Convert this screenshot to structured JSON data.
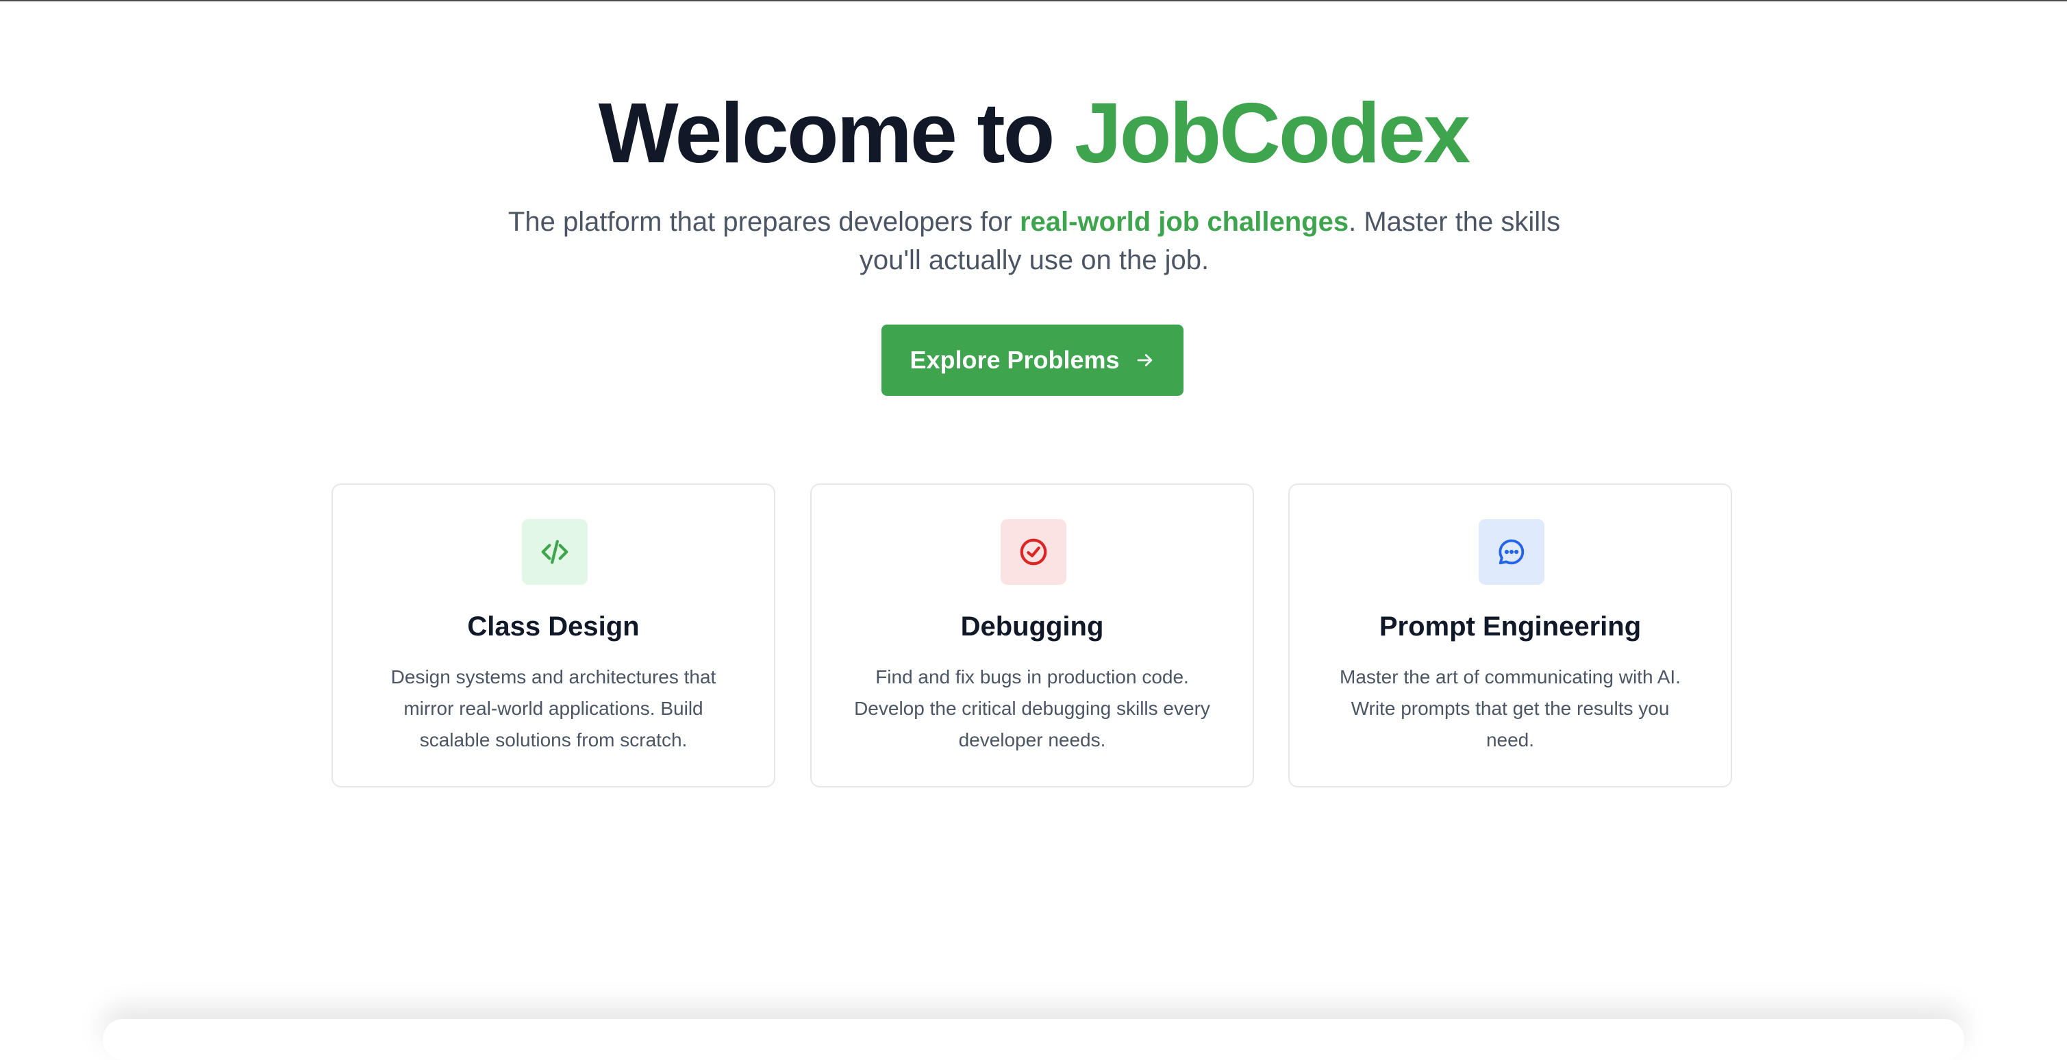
{
  "hero": {
    "title_prefix": "Welcome to ",
    "title_brand": "JobCodex",
    "subtitle_before": "The platform that prepares developers for ",
    "subtitle_highlight": "real-world job challenges",
    "subtitle_after": ". Master the skills you'll actually use on the job.",
    "cta_label": "Explore Problems",
    "cta_icon": "arrow-right-icon"
  },
  "cards": [
    {
      "icon": "code-icon",
      "title": "Class Design",
      "description": "Design systems and architectures that mirror real-world applications. Build scalable solutions from scratch."
    },
    {
      "icon": "check-circle-icon",
      "title": "Debugging",
      "description": "Find and fix bugs in production code. Develop the critical debugging skills every developer needs."
    },
    {
      "icon": "chat-bubble-icon",
      "title": "Prompt Engineering",
      "description": "Master the art of communicating with AI. Write prompts that get the results you need."
    }
  ],
  "colors": {
    "brand_green": "#3ea54e",
    "heading": "#111827",
    "body_text": "#4b5563",
    "debug_red": "#dc2626",
    "prompt_blue": "#2563eb"
  }
}
